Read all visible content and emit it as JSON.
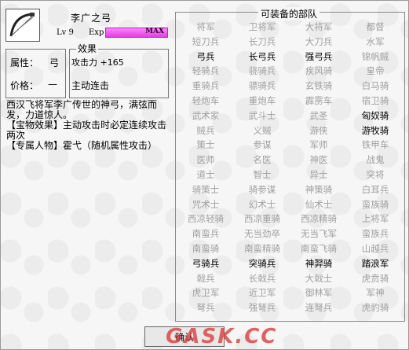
{
  "item": {
    "name": "李广之弓",
    "level": "Lv 9",
    "exp_label": "Exp",
    "exp_value": "MAX",
    "exp_fraction": 1.0
  },
  "attributes": {
    "type_label": "属性：",
    "type_value": "弓",
    "price_label": "价格：",
    "price_value": "—"
  },
  "effect": {
    "title": "效果",
    "stat": "攻击力 +165",
    "skill": "主动连击"
  },
  "description": {
    "lore": "西汉飞将军李广传世的神弓，满弦而发，力道惊人。",
    "treasure_effect": "【宝物效果】主动攻击时必定连续攻击两次",
    "exclusive": "【专属人物】霍弋（随机属性攻击）"
  },
  "units": {
    "title": "可装备的部队",
    "items": [
      {
        "label": "将军",
        "on": false
      },
      {
        "label": "卫将军",
        "on": false
      },
      {
        "label": "大将军",
        "on": false
      },
      {
        "label": "都督",
        "on": false
      },
      {
        "label": "短刀兵",
        "on": false
      },
      {
        "label": "长刀兵",
        "on": false
      },
      {
        "label": "大刀兵",
        "on": false
      },
      {
        "label": "水军",
        "on": false
      },
      {
        "label": "弓兵",
        "on": true
      },
      {
        "label": "长弓兵",
        "on": true
      },
      {
        "label": "强弓兵",
        "on": true
      },
      {
        "label": "锦帆贼",
        "on": false
      },
      {
        "label": "轻骑兵",
        "on": false
      },
      {
        "label": "骁骑兵",
        "on": false
      },
      {
        "label": "疾风骑",
        "on": false
      },
      {
        "label": "皇帝",
        "on": false
      },
      {
        "label": "重骑兵",
        "on": false
      },
      {
        "label": "骠骑兵",
        "on": false
      },
      {
        "label": "玄铁骑",
        "on": false
      },
      {
        "label": "白马骑",
        "on": false
      },
      {
        "label": "轻炮车",
        "on": false
      },
      {
        "label": "重炮车",
        "on": false
      },
      {
        "label": "霹雳车",
        "on": false
      },
      {
        "label": "宿卫骑",
        "on": false
      },
      {
        "label": "武术家",
        "on": false
      },
      {
        "label": "武斗士",
        "on": false
      },
      {
        "label": "武圣",
        "on": false
      },
      {
        "label": "匈奴骑",
        "on": true
      },
      {
        "label": "贼兵",
        "on": false
      },
      {
        "label": "义贼",
        "on": false
      },
      {
        "label": "游侠",
        "on": false
      },
      {
        "label": "游牧骑",
        "on": true
      },
      {
        "label": "策士",
        "on": false
      },
      {
        "label": "参谋",
        "on": false
      },
      {
        "label": "军师",
        "on": false
      },
      {
        "label": "铁甲车",
        "on": false
      },
      {
        "label": "医师",
        "on": false
      },
      {
        "label": "名医",
        "on": false
      },
      {
        "label": "神医",
        "on": false
      },
      {
        "label": "战鬼",
        "on": false
      },
      {
        "label": "道士",
        "on": false
      },
      {
        "label": "智士",
        "on": false
      },
      {
        "label": "异士",
        "on": false
      },
      {
        "label": "突将",
        "on": false
      },
      {
        "label": "骑策士",
        "on": false
      },
      {
        "label": "骑参谋",
        "on": false
      },
      {
        "label": "神策骑",
        "on": false
      },
      {
        "label": "白耳兵",
        "on": false
      },
      {
        "label": "咒术士",
        "on": false
      },
      {
        "label": "幻术士",
        "on": false
      },
      {
        "label": "仙术士",
        "on": false
      },
      {
        "label": "蛮族骑",
        "on": false
      },
      {
        "label": "西凉轻骑",
        "on": false
      },
      {
        "label": "西凉重骑",
        "on": false
      },
      {
        "label": "西凉精骑",
        "on": false
      },
      {
        "label": "上将军",
        "on": false
      },
      {
        "label": "南蛮兵",
        "on": false
      },
      {
        "label": "无当劲卒",
        "on": false
      },
      {
        "label": "无当飞军",
        "on": false
      },
      {
        "label": "蛮族兵",
        "on": false
      },
      {
        "label": "南蛮骑",
        "on": false
      },
      {
        "label": "南蛮精骑",
        "on": false
      },
      {
        "label": "南蛮飞骑",
        "on": false
      },
      {
        "label": "山越兵",
        "on": false
      },
      {
        "label": "弓骑兵",
        "on": true
      },
      {
        "label": "突骑兵",
        "on": true
      },
      {
        "label": "神羿骑",
        "on": true
      },
      {
        "label": "踏浪军",
        "on": true
      },
      {
        "label": "戟兵",
        "on": false
      },
      {
        "label": "长戟兵",
        "on": false
      },
      {
        "label": "大戟士",
        "on": false
      },
      {
        "label": "虎贲骑",
        "on": false
      },
      {
        "label": "虎卫军",
        "on": false
      },
      {
        "label": "近卫军",
        "on": false
      },
      {
        "label": "御林军",
        "on": false
      },
      {
        "label": "军神",
        "on": false
      },
      {
        "label": "弩兵",
        "on": false
      },
      {
        "label": "强弩兵",
        "on": false
      },
      {
        "label": "连弩兵",
        "on": false
      },
      {
        "label": "虎豹骑",
        "on": false
      }
    ]
  },
  "buttons": {
    "confirm": "确认"
  },
  "watermark": "GASK.CC",
  "colors": {
    "exp_bar": "#e040e0",
    "unit_enabled": "#000000",
    "unit_disabled": "#a0a0a0"
  }
}
